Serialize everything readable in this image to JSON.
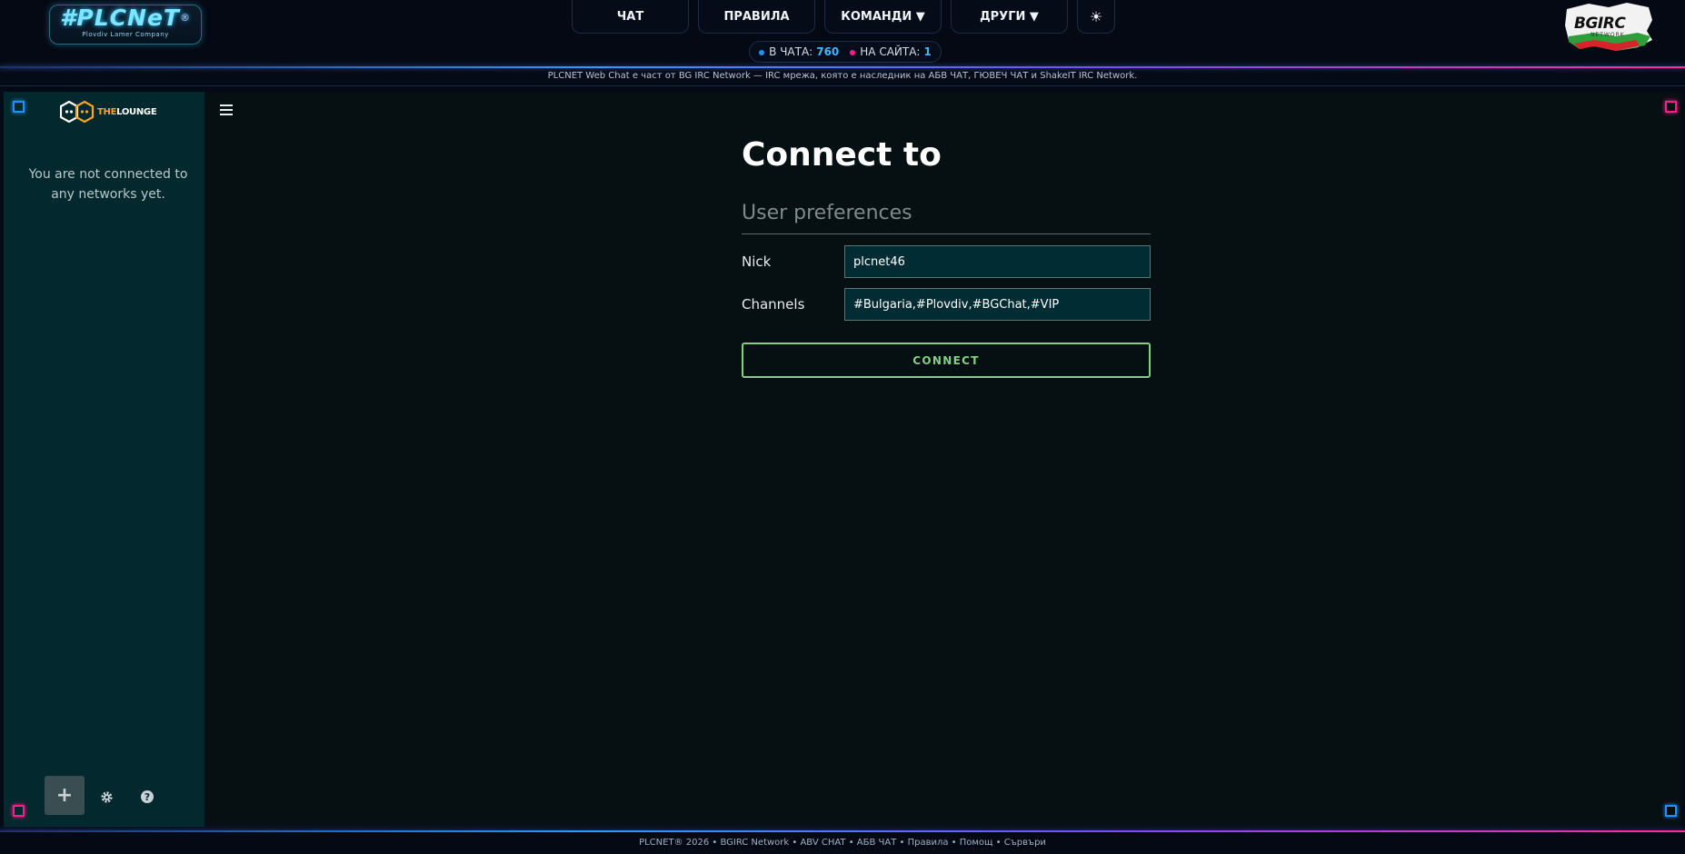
{
  "header": {
    "logo_text": "#PLCNeT",
    "logo_reg": "®",
    "logo_sub": "Plovdiv Lamer Company",
    "nav": [
      {
        "label": "ЧАТ"
      },
      {
        "label": "ПРАВИЛА"
      },
      {
        "label": "КОМАНДИ ▼"
      },
      {
        "label": "ДРУГИ ▼"
      },
      {
        "label": "☀"
      }
    ],
    "stats": {
      "chat_label": "В ЧАТА:",
      "chat_count": "760",
      "site_label": "НА САЙТА:",
      "site_count": "1"
    },
    "right_logo_text": "BGIRC",
    "right_logo_sub": "NETWORK",
    "tagline": "PLCNET Web Chat е част от BG IRC Network — IRC мрежа, която е наследник на АБВ ЧАТ, ГЮВЕЧ ЧАТ и ShakeIT IRC Network."
  },
  "sidebar": {
    "logo_the": "THE",
    "logo_lounge": "LOUNGE",
    "empty_message": "You are not connected to any networks yet.",
    "footer": [
      {
        "icon": "plus-icon",
        "glyph": "+"
      },
      {
        "icon": "gear-icon",
        "glyph": "⚙"
      },
      {
        "icon": "help-icon",
        "glyph": "?"
      }
    ]
  },
  "connect": {
    "title": "Connect to",
    "section": "User preferences",
    "nick_label": "Nick",
    "nick_value": "plcnet46",
    "channels_label": "Channels",
    "channels_value": "#Bulgaria,#Plovdiv,#BGChat,#VIP",
    "button": "CONNECT"
  },
  "colors": {
    "accent_blue": "#1e90ff",
    "accent_pink": "#ff1d8e",
    "connect_green": "#84ce88",
    "sidebar_bg": "#03282d"
  },
  "footer_text": "PLCNET® 2026 • BGIRC Network • ABV CHAT • АБВ ЧАТ • Правила • Помощ • Сървъри"
}
